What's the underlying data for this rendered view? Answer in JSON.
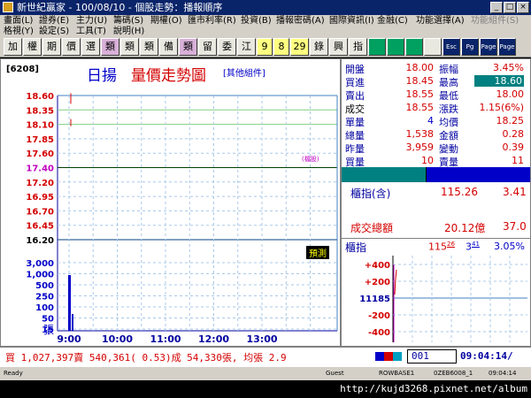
{
  "title_bar": {
    "title": "新世紀贏家 - 100/08/10 - 個股走勢：播報順序",
    "minimize": "_",
    "maximize": "□",
    "close": "×"
  },
  "menu": {
    "row1": [
      "畫面(L)",
      "證券(E)",
      "主力(U)",
      "籌碼(S)",
      "期權(O)",
      "匯市利率(R)",
      "投資(B)",
      "播報密碼(A)",
      "國際資訊(I)",
      "金融(C)",
      "功能選擇(A)",
      "功能組件(S)"
    ],
    "row2": [
      "格視(Y)",
      "設定(S)",
      "工具(T)",
      "說明(H)"
    ]
  },
  "toolbar": {
    "buttons": [
      "加",
      "權",
      "期",
      "價",
      "選",
      "類",
      "類",
      "類",
      "備",
      "類",
      "留",
      "委",
      "江",
      "9",
      "8",
      "29",
      "錄",
      "興",
      "指"
    ],
    "extra": [
      "Esc",
      "Pg",
      "Page",
      "Page"
    ]
  },
  "chart": {
    "stock_code": "[6208]",
    "stock_name": "日揚",
    "chart_title": "量價走勢圖",
    "sub_link": "[其他組件]",
    "ref_label": "(檔股)",
    "max_label": "預測",
    "volume_unit": "張",
    "colors": {
      "red": "#d40000",
      "green": "#00a000",
      "black": "#000000",
      "blue": "#0000c8"
    }
  },
  "chart_data": {
    "type": "line",
    "x_ticks": [
      "9:00",
      "10:00",
      "11:00",
      "12:00",
      "13:00"
    ],
    "price_ticks": [
      "18.60",
      "18.35",
      "18.10",
      "17.85",
      "17.60",
      "17.40",
      "17.20",
      "16.95",
      "16.70",
      "16.45",
      "16.20"
    ],
    "reference_price": 17.4,
    "ylim": [
      16.2,
      18.6
    ],
    "volume_ticks": [
      "3,000",
      "1,000",
      "500",
      "250",
      "100",
      "50",
      "15"
    ],
    "price_series": [
      {
        "name": "價",
        "points": [
          [
            "9:00",
            18.55
          ],
          [
            "9:01",
            18.5
          ]
        ]
      }
    ],
    "volume_series": [
      {
        "name": "量",
        "values": [
          1538
        ]
      }
    ]
  },
  "quote": {
    "rows": [
      {
        "l1": "開盤",
        "v1": "18.00",
        "l2": "振幅",
        "v2": "3.45%"
      },
      {
        "l1": "買進",
        "v1": "18.45",
        "l2": "最高",
        "v2": "18.60"
      },
      {
        "l1": "賣出",
        "v1": "18.55",
        "l2": "最低",
        "v2": "18.00"
      },
      {
        "l1": "成交",
        "v1": "18.55",
        "l2": "漲跌",
        "v2": "1.15(6%)"
      },
      {
        "l1": "單量",
        "v1": "4",
        "l2": "均價",
        "v2": "18.25"
      },
      {
        "l1": "總量",
        "v1": "1,538",
        "l2": "金額",
        "v2": "0.28"
      },
      {
        "l1": "昨量",
        "v1": "3,959",
        "l2": "變動",
        "v2": "0.39"
      },
      {
        "l1": "買量",
        "v1": "10",
        "l2": "賣量",
        "v2": "11"
      }
    ],
    "index_label": "櫃指(含)",
    "index_value": "115.26",
    "index_change": "3.41",
    "turnover_label": "成交總額",
    "turnover_value": "20.12億",
    "turnover_change": "37.0",
    "mini_label": "櫃指",
    "mini_value": "115",
    "mini_value_sup": "26",
    "mini_change": "3",
    "mini_change_sup": "41",
    "mini_pct": "3.05%",
    "mini_ticks": [
      "+400",
      "+200",
      "11185",
      "-200",
      "-400"
    ]
  },
  "bottom": {
    "ticker": "買 1,027,397賣  540,361( 0.53)成  54,330張, 均張 2.9",
    "page_box": "001",
    "clock": "09:04:14/"
  },
  "status": {
    "left": "Ready",
    "guest": "Guest",
    "code1": "ROWBASE1",
    "code2": "0ZEB6008_1",
    "time": "09:04:14"
  },
  "watermark": "http://kujd3268.pixnet.net/album"
}
